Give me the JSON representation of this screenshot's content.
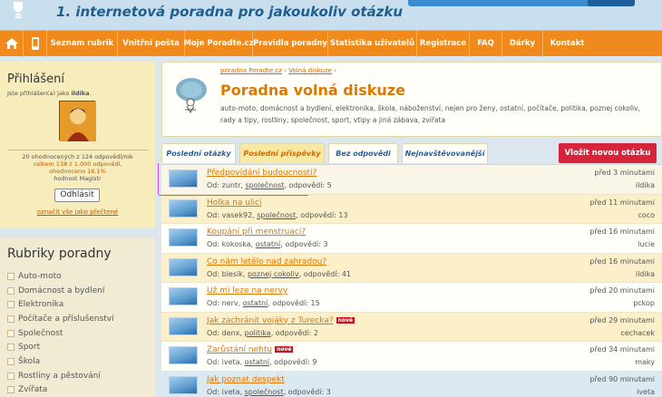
{
  "header": {
    "title": "1. internetová poradna pro jakoukoliv otázku"
  },
  "nav": {
    "items": [
      {
        "label": "Seznam rubrik"
      },
      {
        "label": "Vnitřní pošta"
      },
      {
        "label": "Moje Poradte.cz"
      },
      {
        "label": "Pravidla poradny"
      },
      {
        "label": "Statistika uživatelů"
      },
      {
        "label": "Registrace"
      },
      {
        "label": "FAQ"
      },
      {
        "label": "Dárky"
      },
      {
        "label": "Kontakt"
      }
    ]
  },
  "login": {
    "heading": "Přihlášení",
    "logged_in_prefix": "Jste přihlášen(a) jako",
    "username": "ildika",
    "stats_line1": "20 ohodnocených z 124 odpovědí/rok",
    "stats_line2": "celkem 138 z 1.000 odpovědí,",
    "stats_line3": "ohodnoceno 16.1%",
    "stats_line4": "hodnost Magistr",
    "logout_label": "Odhlásit",
    "mark_read_label": "označit vše jako přečtené"
  },
  "rubriky": {
    "heading": "Rubriky poradny",
    "items": [
      "Auto-moto",
      "Domácnost a bydlení",
      "Elektronika",
      "Počítače a příslušenství",
      "Společnost",
      "Sport",
      "Škola",
      "Rostliny a pěstování",
      "Zvířata"
    ]
  },
  "breadcrumb": {
    "root": "poradna Poradte.cz",
    "sep": "›",
    "current": "Volná diskuze"
  },
  "section": {
    "title": "Poradna volná diskuze",
    "description": "auto-moto, domácnost a bydlení, elektronika, škola, náboženství, nejen pro ženy, ostatní, počítače, politika, poznej cokoliv, rady a tipy, rostliny, společnost, sport, vtipy a jiná zábava, zvířata"
  },
  "tabs": {
    "items": [
      {
        "label": "Poslední otázky"
      },
      {
        "label": "Poslední příspěvky"
      },
      {
        "label": "Bez odpovědi"
      },
      {
        "label": "Nejnavštěvovanější"
      }
    ],
    "new_question": "Vložit novou otázku"
  },
  "questions": [
    {
      "title": "Předpovídání budoucnosti?",
      "from": "Od: zuntr,",
      "category": "společnost",
      "answers": ", odpovědí: 5",
      "time": "před 3 minutami",
      "user": "ildika",
      "badge": ""
    },
    {
      "title": "Holka na ulici",
      "from": "Od: vasek92,",
      "category": "společnost",
      "answers": ", odpovědí: 13",
      "time": "před 11 minutami",
      "user": "coco",
      "badge": ""
    },
    {
      "title": "Koupání při menstruaci?",
      "from": "Od: kokoska,",
      "category": "ostatní",
      "answers": ", odpovědí: 3",
      "time": "před 16 minutami",
      "user": "lucie",
      "badge": ""
    },
    {
      "title": "Co nám letělo nad zahradou?",
      "from": "Od: blesik,",
      "category": "poznej cokoliv",
      "answers": ", odpovědí: 41",
      "time": "před 16 minutami",
      "user": "ildika",
      "badge": ""
    },
    {
      "title": "Už mi leze na nervy",
      "from": "Od: nerv,",
      "category": "ostatní",
      "answers": ", odpovědí: 15",
      "time": "před 20 minutami",
      "user": "pckop",
      "badge": ""
    },
    {
      "title": "Jak zachránit vojáky z Turecka?",
      "from": "Od: denx,",
      "category": "politika",
      "answers": ", odpovědí: 2",
      "time": "před 29 minutami",
      "user": "cechacek",
      "badge": "nové"
    },
    {
      "title": "Zarůstání nehtu",
      "from": "Od: iveta,",
      "category": "ostatní",
      "answers": ", odpovědí: 9",
      "time": "před 34 minutami",
      "user": "maky",
      "badge": "nové"
    },
    {
      "title": "Jak poznat despekt",
      "from": "Od: iveta,",
      "category": "společnost",
      "answers": ", odpovědí: 3",
      "time": "před 90 minutami",
      "user": "iveta",
      "badge": ""
    }
  ],
  "colors": {
    "accent": "#f08a1c",
    "link": "#e07700",
    "new_question": "#d8243a",
    "badge": "#c5121e"
  }
}
